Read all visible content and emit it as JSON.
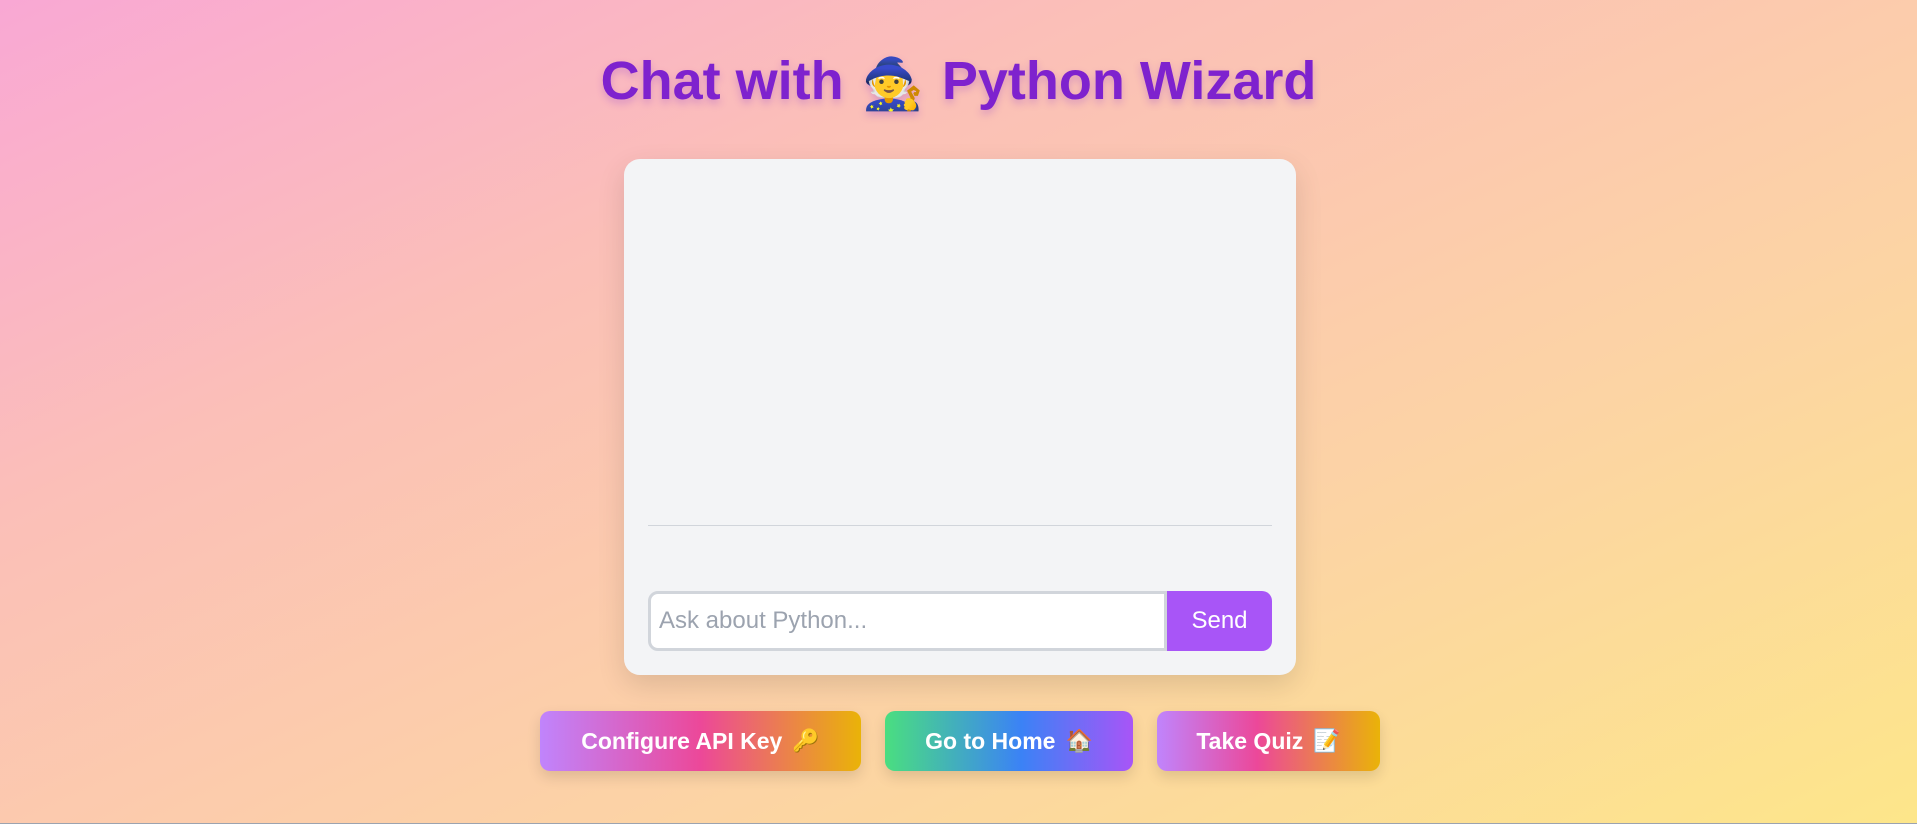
{
  "header": {
    "title_prefix": "Chat with",
    "title_icon": "🧙",
    "title_suffix": "Python Wizard"
  },
  "chat": {
    "messages": [],
    "input_placeholder": "Ask about Python...",
    "input_value": "",
    "send_label": "Send"
  },
  "actions": {
    "config": {
      "label": "Configure API Key",
      "icon": "🔑"
    },
    "home": {
      "label": "Go to Home",
      "icon": "🏠"
    },
    "quiz": {
      "label": "Take Quiz",
      "icon": "📝"
    }
  },
  "colors": {
    "title": "#7e22ce",
    "send_button": "#a855f7",
    "card_background": "#f3f4f6"
  }
}
